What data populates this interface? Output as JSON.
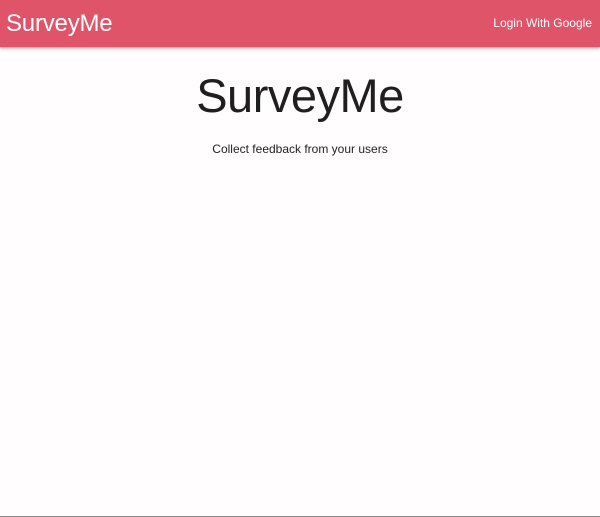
{
  "navbar": {
    "brand": "SurveyMe",
    "login_label": "Login With Google",
    "background_color": "#e05469"
  },
  "hero": {
    "title": "SurveyMe",
    "subtitle": "Collect feedback from your users"
  }
}
